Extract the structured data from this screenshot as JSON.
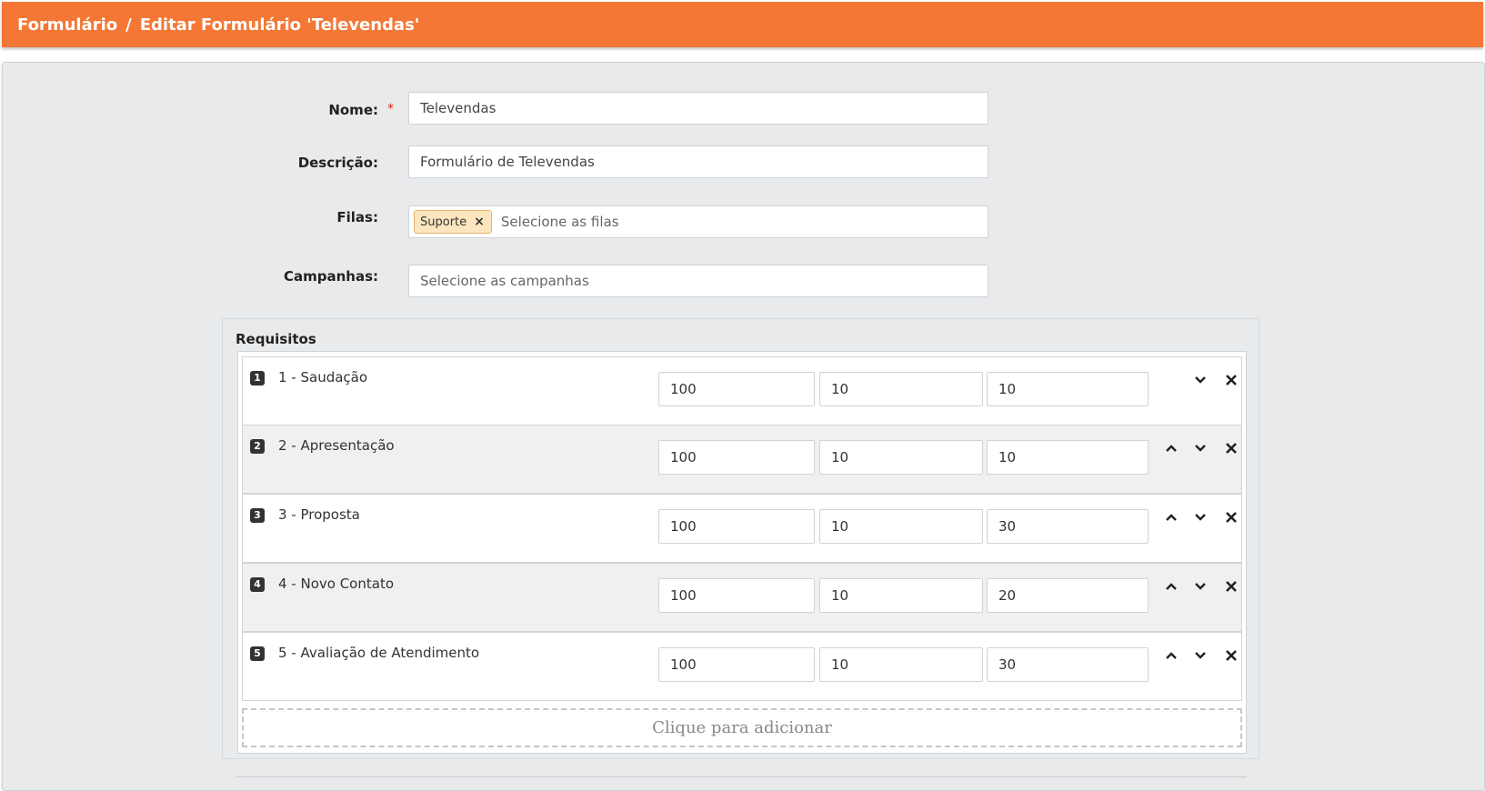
{
  "breadcrumb": {
    "root": "Formulário",
    "separator": "/",
    "current": "Editar Formulário 'Televendas'"
  },
  "form": {
    "nome_label": "Nome:",
    "nome_value": "Televendas",
    "required_mark": "*",
    "descricao_label": "Descrição:",
    "descricao_value": "Formulário de Televendas",
    "filas_label": "Filas:",
    "filas_tag": "Suporte",
    "filas_tag_remove": "×",
    "filas_placeholder": "Selecione as filas",
    "campanhas_label": "Campanhas:",
    "campanhas_placeholder": "Selecione as campanhas"
  },
  "requisitos": {
    "title": "Requisitos",
    "items": [
      {
        "badge": "1",
        "name": "1 - Saudação",
        "v1": "100",
        "v2": "10",
        "v3": "10"
      },
      {
        "badge": "2",
        "name": "2 - Apresentação",
        "v1": "100",
        "v2": "10",
        "v3": "10"
      },
      {
        "badge": "3",
        "name": "3 - Proposta",
        "v1": "100",
        "v2": "10",
        "v3": "30"
      },
      {
        "badge": "4",
        "name": "4 - Novo Contato",
        "v1": "100",
        "v2": "10",
        "v3": "20"
      },
      {
        "badge": "5",
        "name": "5 - Avaliação de Atendimento",
        "v1": "100",
        "v2": "10",
        "v3": "30"
      }
    ],
    "add_label": "Clique para adicionar"
  },
  "colors": {
    "header": "#f47735",
    "panel": "#e8eaec",
    "required": "#d9230f",
    "tag_bg": "#fde6bf"
  },
  "icons": {
    "up": "chevron-up-icon",
    "down": "chevron-down-icon",
    "remove": "close-icon"
  }
}
